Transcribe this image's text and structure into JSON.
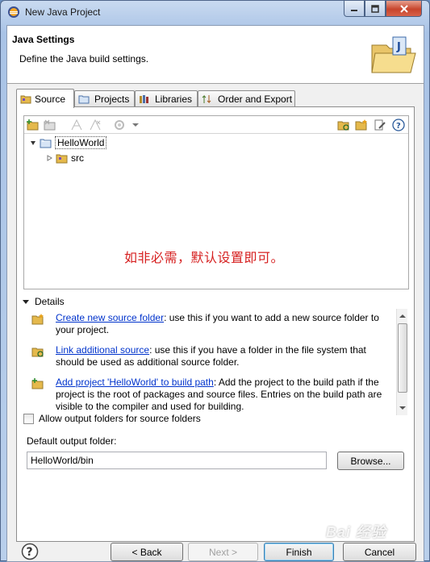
{
  "window": {
    "title": "New Java Project"
  },
  "header": {
    "title": "Java Settings",
    "description": "Define the Java build settings."
  },
  "tabs": [
    {
      "label": "Source",
      "icon": "source-folder-icon",
      "active": true
    },
    {
      "label": "Projects",
      "icon": "projects-icon",
      "active": false
    },
    {
      "label": "Libraries",
      "icon": "libraries-icon",
      "active": false
    },
    {
      "label": "Order and Export",
      "icon": "order-export-icon",
      "active": false
    }
  ],
  "tree": {
    "project": "HelloWorld",
    "children": [
      {
        "label": "src",
        "icon": "package-folder-icon"
      }
    ]
  },
  "annotation": "如非必需，默认设置即可。",
  "details": {
    "heading": "Details",
    "items": [
      {
        "link": "Create new source folder",
        "text": ": use this if you want to add a new source folder to your project."
      },
      {
        "link": "Link additional source",
        "text": ": use this if you have a folder in the file system that should be used as additional source folder."
      },
      {
        "link": "Add project 'HelloWorld' to build path",
        "text": ": Add the project to the build path if the project is the root of packages and source files. Entries on the build path are visible to the compiler and used for building."
      }
    ]
  },
  "allow_output": {
    "label": "Allow output folders for source folders",
    "checked": false
  },
  "output": {
    "label": "Default output folder:",
    "value": "HelloWorld/bin",
    "browse": "Browse..."
  },
  "buttons": {
    "back": "< Back",
    "next": "Next >",
    "finish": "Finish",
    "cancel": "Cancel"
  },
  "watermark": "Bai 经验",
  "colors": {
    "link": "#0033cc",
    "annotation": "#d62020"
  }
}
